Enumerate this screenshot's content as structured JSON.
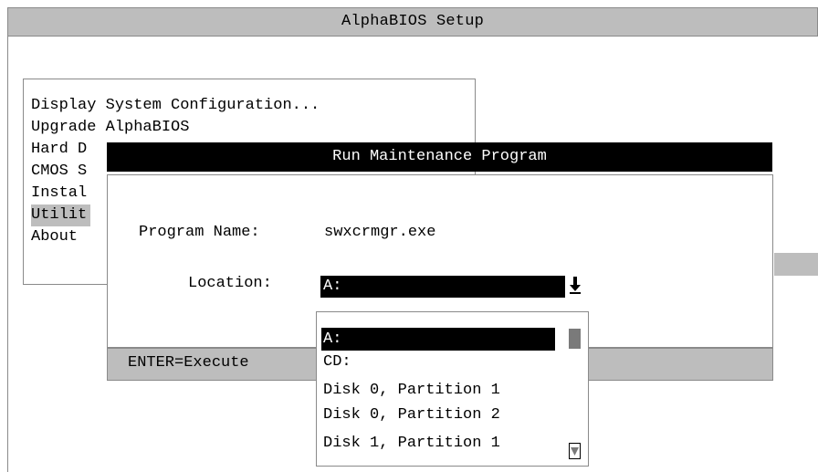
{
  "app": {
    "title": "AlphaBIOS Setup"
  },
  "main_menu": {
    "items": [
      {
        "label": "Display System Configuration..."
      },
      {
        "label": "Upgrade AlphaBIOS"
      },
      {
        "label": "Hard D"
      },
      {
        "label": "CMOS S"
      },
      {
        "label": "Instal"
      },
      {
        "label": "Utilit",
        "selected": true
      },
      {
        "label": "About"
      }
    ]
  },
  "dialog": {
    "title": "Run Maintenance Program",
    "program_name_label": "Program Name:",
    "program_name_value": "swxcrmgr.exe",
    "location_label": "Location:",
    "location_value": "A:",
    "location_options": [
      "A:",
      "CD:",
      "Disk 0, Partition 1",
      "Disk 0, Partition 2",
      "Disk 1, Partition 1"
    ],
    "selected_index": 0
  },
  "status_bar": {
    "text": "ENTER=Execute"
  },
  "icons": {
    "dropdown": "dropdown-arrow-icon",
    "scroll_down": "scroll-down-arrow-icon"
  },
  "colors": {
    "background": "#ffffff",
    "bar_gray": "#bdbdbd",
    "highlight": "#000000"
  }
}
